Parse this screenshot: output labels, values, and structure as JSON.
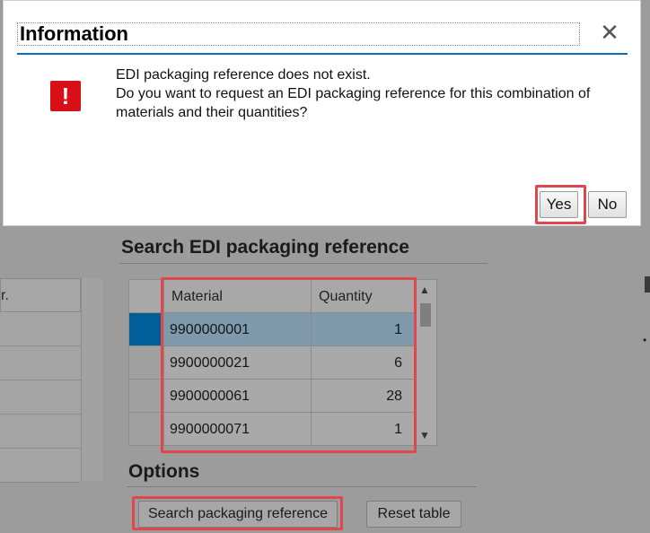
{
  "dialog": {
    "title": "Information",
    "close_icon": "close-icon",
    "error_icon": "!",
    "message_lines": [
      "EDI packaging reference does not exist.",
      "Do you want to request an EDI packaging reference for this combination of",
      "materials and their quantities?"
    ],
    "yes_label": "Yes",
    "no_label": "No"
  },
  "background": {
    "left_table_header": "r.",
    "search_section_title": "Search EDI packaging reference",
    "options_section_title": "Options",
    "table": {
      "columns": [
        "Material",
        "Quantity"
      ],
      "rows": [
        {
          "material": "9900000001",
          "quantity": "1"
        },
        {
          "material": "9900000021",
          "quantity": "6"
        },
        {
          "material": "9900000061",
          "quantity": "28"
        },
        {
          "material": "9900000071",
          "quantity": "1"
        }
      ],
      "selected_row": 0
    },
    "search_button_label": "Search packaging reference",
    "reset_button_label": "Reset table"
  },
  "colors": {
    "highlight": "#e0474c",
    "dialog_accent": "#0a6fb8",
    "error_red": "#d90f17",
    "selected_row_marker": "#005f98"
  }
}
